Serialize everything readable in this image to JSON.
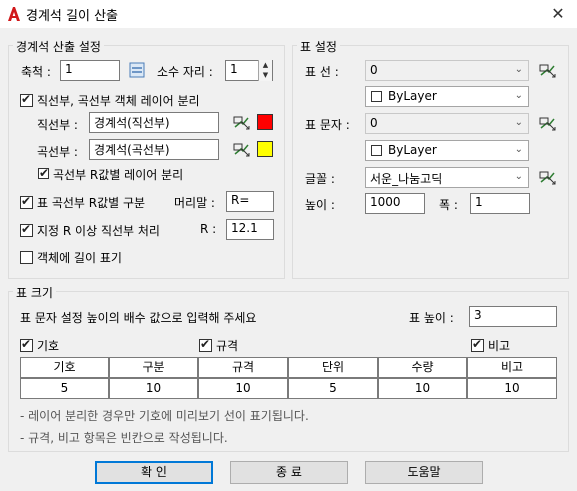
{
  "window": {
    "title": "경계석 길이 산출",
    "close": "✕"
  },
  "calc": {
    "legend": "경계석 산출 설정",
    "scale_label": "축척 :",
    "scale_value": "1",
    "decimal_label": "소수 자리 :",
    "decimal_value": "1",
    "split_layer_label": "직선부, 곡선부 객체 레이어 분리",
    "split_layer_checked": true,
    "straight_label": "직선부 :",
    "straight_value": "경계석(직선부)",
    "straight_color": "#ff0000",
    "curve_label": "곡선부 :",
    "curve_value": "경계석(곡선부)",
    "curve_color": "#ffff00",
    "curve_r_split_label": "곡선부 R값별 레이어 분리",
    "curve_r_split_checked": true,
    "table_curve_label": "표 곡선부 R값별 구분",
    "table_curve_checked": true,
    "prefix_label": "머리말 :",
    "prefix_value": "R=",
    "r_over_label": "지정 R 이상 직선부 처리",
    "r_over_checked": true,
    "r_label": "R :",
    "r_value": "12.1",
    "show_length_label": "객체에 길이 표기",
    "show_length_checked": false
  },
  "table_settings": {
    "legend": "표 설정",
    "line_label": "표 선 :",
    "line_value": "0",
    "line_color": "ByLayer",
    "text_label": "표 문자 :",
    "text_value": "0",
    "text_color": "ByLayer",
    "font_label": "글꼴 :",
    "font_value": "서운_나눔고딕",
    "height_label": "높이 :",
    "height_value": "1000",
    "width_label": "폭 :",
    "width_value": "1"
  },
  "table_size": {
    "legend": "표 크기",
    "instruction": "표 문자 설정 높이의 배수 값으로 입력해 주세요",
    "height_label": "표 높이 :",
    "height_value": "3",
    "check_symbol": "기호",
    "check_spec": "규격",
    "check_remark": "비고",
    "columns": [
      "기호",
      "구분",
      "규격",
      "단위",
      "수량",
      "비고"
    ],
    "values": [
      "5",
      "10",
      "10",
      "5",
      "10",
      "10"
    ],
    "note1": "- 레이어 분리한 경우만 기호에 미리보기 선이 표기됩니다.",
    "note2": "- 규격, 비고 항목은 빈칸으로 작성됩니다."
  },
  "buttons": {
    "ok": "확 인",
    "exit": "종 료",
    "help": "도움말"
  },
  "icons": {
    "app": "autocad-a-icon",
    "pick": "layer-pick-icon",
    "settings": "settings-icon"
  }
}
